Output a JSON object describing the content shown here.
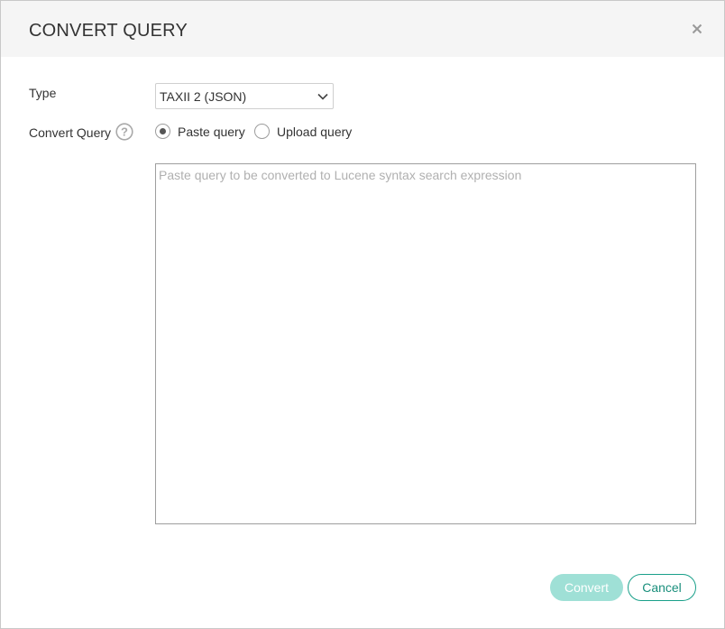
{
  "dialog": {
    "title": "CONVERT QUERY",
    "close_icon": "close-icon"
  },
  "form": {
    "type_label": "Type",
    "type_select": {
      "selected": "TAXII 2 (JSON)",
      "icon": "chevron-down-icon"
    },
    "convert_query_label": "Convert Query",
    "help_icon": "help-circle-icon",
    "help_glyph": "?",
    "radios": [
      {
        "label": "Paste query",
        "checked": true
      },
      {
        "label": "Upload query",
        "checked": false
      }
    ],
    "query_textarea": {
      "value": "",
      "placeholder": "Paste query to be converted to Lucene syntax search expression"
    }
  },
  "footer": {
    "convert_label": "Convert",
    "cancel_label": "Cancel"
  },
  "colors": {
    "header_bg": "#f5f5f5",
    "accent": "#1aa08a",
    "convert_disabled": "#9fe0d6",
    "text": "#333333",
    "placeholder": "#b0b0b0"
  }
}
